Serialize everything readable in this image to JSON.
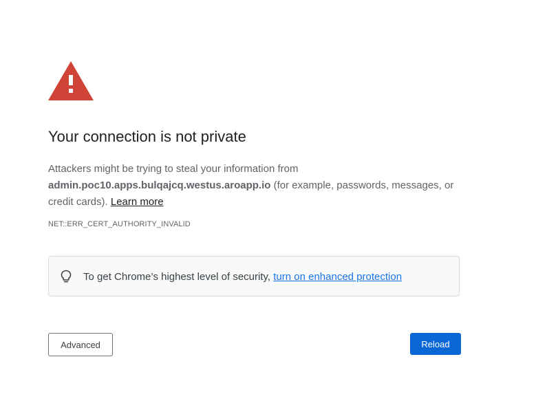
{
  "interstitial": {
    "title": "Your connection is not private",
    "message_prefix": "Attackers might be trying to steal your information from ",
    "host": "admin.poc10.apps.bulqajcq.westus.aroapp.io",
    "message_suffix": " (for example, passwords, messages, or credit cards). ",
    "learn_more_label": "Learn more",
    "error_code": "NET::ERR_CERT_AUTHORITY_INVALID",
    "warning_icon": "warning-triangle-icon",
    "warning_color": "#d04437"
  },
  "enhanced_protection": {
    "icon": "lightbulb-icon",
    "text": "To get Chrome’s highest level of security, ",
    "link_label": "turn on enhanced protection"
  },
  "buttons": {
    "advanced_label": "Advanced",
    "reload_label": "Reload",
    "reload_color": "#0b66d6"
  }
}
